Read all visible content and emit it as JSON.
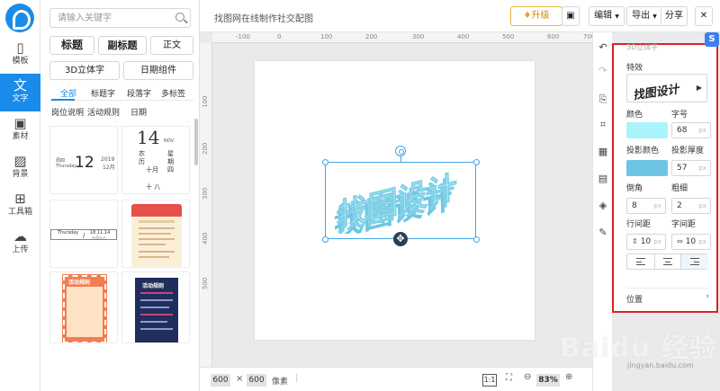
{
  "app": {
    "document_title": "找图网在线制作社交配图"
  },
  "nav": {
    "items": [
      {
        "label": "模板",
        "icon": "template-icon"
      },
      {
        "label": "文字",
        "icon": "text-icon",
        "active": true
      },
      {
        "label": "素材",
        "icon": "image-icon"
      },
      {
        "label": "背景",
        "icon": "background-icon"
      },
      {
        "label": "工具箱",
        "icon": "toolbox-icon"
      },
      {
        "label": "上传",
        "icon": "upload-icon"
      }
    ]
  },
  "panel": {
    "search_placeholder": "请输入关键字",
    "buttons": {
      "title": "标题",
      "subtitle": "副标题",
      "body": "正文",
      "text3d": "3D立体字",
      "date_widget": "日期组件"
    },
    "tabs": [
      "全部",
      "标题字",
      "段落字",
      "多标签"
    ],
    "tabs_row2": [
      "岗位说明",
      "活动规则",
      "日期"
    ],
    "cards": {
      "date1": {
        "weekday_cn": "周四",
        "weekday_en": "Thursday",
        "day": "12",
        "year": "2019",
        "month": "12月"
      },
      "date2": {
        "day": "14",
        "month_en": "NOV.",
        "lunar": [
          "农",
          "历",
          "十",
          "月",
          "十",
          "八"
        ],
        "weekday": [
          "星",
          "期",
          "四"
        ]
      },
      "date3": {
        "weekday": "Thursday",
        "date": "18.11.14",
        "lunar": "十月十八"
      },
      "poster1": {
        "title": "活动规则"
      },
      "poster2": {
        "title": "活动规则"
      }
    }
  },
  "topbar": {
    "upgrade": "升级",
    "edit": "编辑",
    "export": "导出",
    "share": "分享"
  },
  "ruler": {
    "top": [
      "-100",
      "0",
      "100",
      "200",
      "300",
      "400",
      "500",
      "600",
      "700"
    ],
    "left": [
      "100",
      "200",
      "300",
      "400",
      "500"
    ]
  },
  "canvas": {
    "text_art": "找图设计"
  },
  "bottombar": {
    "width": "600",
    "times": "×",
    "height": "600",
    "unit": "像素",
    "ratio": "1:1",
    "zoom": "83%"
  },
  "properties": {
    "panel_title": "3D立体字",
    "effect_label": "特效",
    "effect_preview": "找图设计",
    "color_label": "颜色",
    "color_value": "#aaf3fb",
    "font_size_label": "字号",
    "font_size": "68",
    "shadow_color_label": "投影颜色",
    "shadow_color_value": "#6ec5e3",
    "shadow_depth_label": "投影厚度",
    "shadow_depth": "57",
    "angle_label": "倒角",
    "angle": "8",
    "weight_label": "粗细",
    "weight": "2",
    "line_height_label": "行间距",
    "line_height": "10",
    "letter_spacing_label": "字间距",
    "letter_spacing": "10",
    "unit": "px",
    "position_label": "位置"
  },
  "watermark": {
    "main": "Baidu 经验",
    "sub": "jingyan.baidu.com"
  },
  "colors": {
    "accent": "#1a8be8",
    "highlight_border": "#e02020"
  }
}
